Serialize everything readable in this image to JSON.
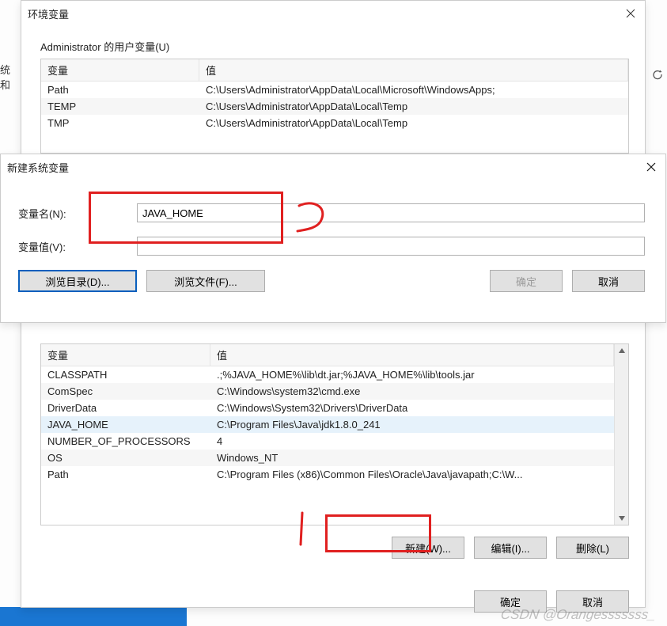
{
  "env_window": {
    "title": "环境变量",
    "user_section_label": "Administrator 的用户变量(U)",
    "col_var": "变量",
    "col_val": "值",
    "user_vars": [
      {
        "name": "Path",
        "value": "C:\\Users\\Administrator\\AppData\\Local\\Microsoft\\WindowsApps;"
      },
      {
        "name": "TEMP",
        "value": "C:\\Users\\Administrator\\AppData\\Local\\Temp"
      },
      {
        "name": "TMP",
        "value": "C:\\Users\\Administrator\\AppData\\Local\\Temp"
      }
    ],
    "sys_vars": [
      {
        "name": "CLASSPATH",
        "value": ".;%JAVA_HOME%\\lib\\dt.jar;%JAVA_HOME%\\lib\\tools.jar"
      },
      {
        "name": "ComSpec",
        "value": "C:\\Windows\\system32\\cmd.exe"
      },
      {
        "name": "DriverData",
        "value": "C:\\Windows\\System32\\Drivers\\DriverData"
      },
      {
        "name": "JAVA_HOME",
        "value": "C:\\Program Files\\Java\\jdk1.8.0_241",
        "selected": true
      },
      {
        "name": "NUMBER_OF_PROCESSORS",
        "value": "4"
      },
      {
        "name": "OS",
        "value": "Windows_NT"
      },
      {
        "name": "Path",
        "value": "C:\\Program Files (x86)\\Common Files\\Oracle\\Java\\javapath;C:\\W..."
      }
    ],
    "btn_new": "新建(W)...",
    "btn_edit": "编辑(I)...",
    "btn_delete": "删除(L)",
    "btn_ok": "确定",
    "btn_cancel": "取消"
  },
  "edit_window": {
    "title": "新建系统变量",
    "label_name": "变量名(N):",
    "label_value": "变量值(V):",
    "value_name": "JAVA_HOME",
    "value_value": "",
    "btn_browse_dir": "浏览目录(D)...",
    "btn_browse_file": "浏览文件(F)...",
    "btn_ok": "确定",
    "btn_cancel": "取消"
  },
  "side_fragment": "统和",
  "watermark": "CSDN @Orangesssssss_"
}
